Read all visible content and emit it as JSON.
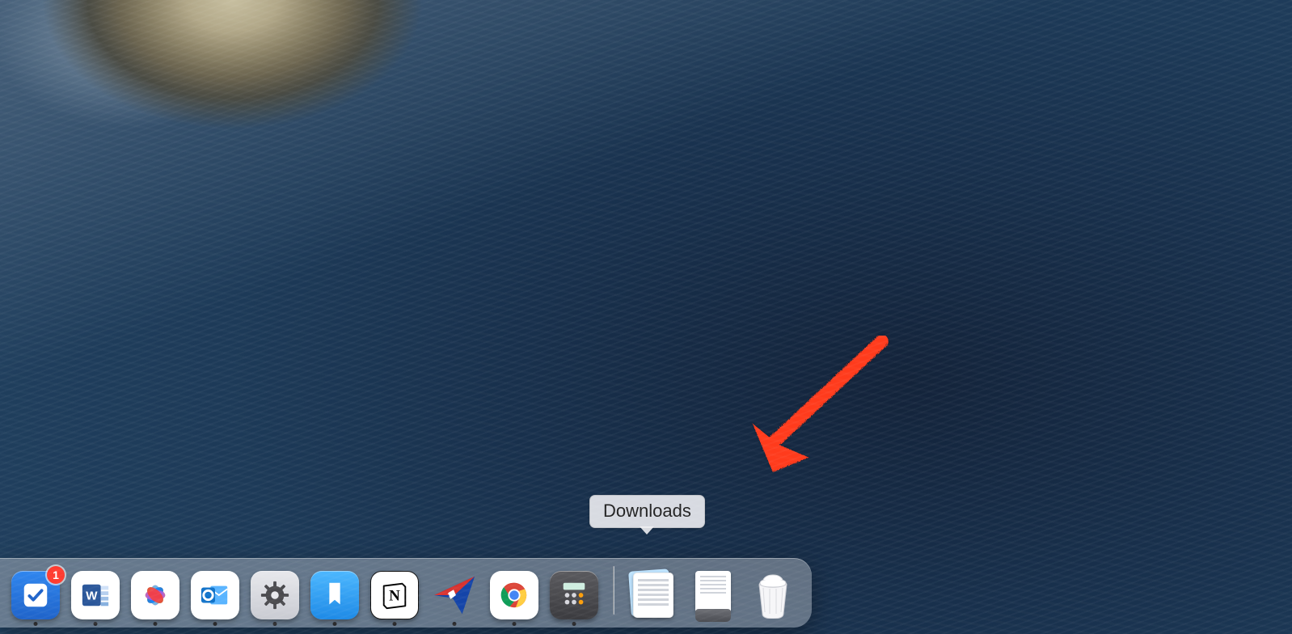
{
  "tooltip": {
    "label": "Downloads"
  },
  "annotation": {
    "arrow_color": "#ff3b1f"
  },
  "dock": {
    "apps": [
      {
        "name": "things",
        "label": "Things",
        "running": true,
        "badge": "1"
      },
      {
        "name": "word",
        "label": "Microsoft Word",
        "running": true
      },
      {
        "name": "photos",
        "label": "Photos",
        "running": true
      },
      {
        "name": "outlook",
        "label": "Microsoft Outlook",
        "running": true
      },
      {
        "name": "settings",
        "label": "System Preferences",
        "running": true
      },
      {
        "name": "journal",
        "label": "Journal",
        "running": true
      },
      {
        "name": "notion",
        "label": "Notion",
        "running": true,
        "letter": "N"
      },
      {
        "name": "tracker",
        "label": "Tracker",
        "running": true
      },
      {
        "name": "chrome",
        "label": "Google Chrome",
        "running": true
      },
      {
        "name": "calc",
        "label": "Calculator",
        "running": true
      }
    ],
    "stacks": [
      {
        "name": "downloads",
        "label": "Downloads"
      },
      {
        "name": "documents",
        "label": "Documents"
      }
    ],
    "trash": {
      "label": "Trash",
      "full": true
    }
  }
}
